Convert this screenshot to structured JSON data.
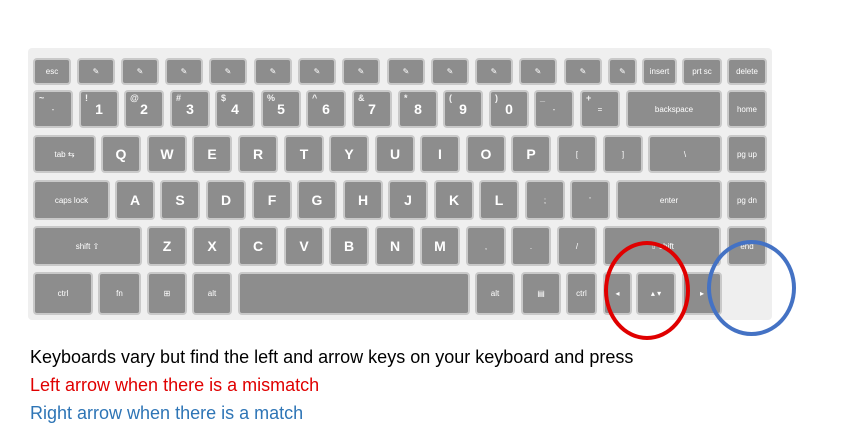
{
  "keyboard": {
    "rows": [
      [
        {
          "label": "esc"
        },
        {
          "label": "✎"
        },
        {
          "label": "✎"
        },
        {
          "label": "✎"
        },
        {
          "label": "✎"
        },
        {
          "label": "✎"
        },
        {
          "label": "✎"
        },
        {
          "label": "✎"
        },
        {
          "label": "✎"
        },
        {
          "label": "✎"
        },
        {
          "label": "✎"
        },
        {
          "label": "✎"
        },
        {
          "label": "✎"
        },
        {
          "label": "✎"
        },
        {
          "label": "insert"
        },
        {
          "label": "prt sc"
        },
        {
          "label": "delete"
        }
      ],
      [
        {
          "label": "-",
          "sec": "~"
        },
        {
          "label": "1",
          "sec": "!"
        },
        {
          "label": "2",
          "sec": "@"
        },
        {
          "label": "3",
          "sec": "#"
        },
        {
          "label": "4",
          "sec": "$"
        },
        {
          "label": "5",
          "sec": "%"
        },
        {
          "label": "6",
          "sec": "^"
        },
        {
          "label": "7",
          "sec": "&"
        },
        {
          "label": "8",
          "sec": "*"
        },
        {
          "label": "9",
          "sec": "("
        },
        {
          "label": "0",
          "sec": ")"
        },
        {
          "label": "-",
          "sec": "_"
        },
        {
          "label": "=",
          "sec": "+"
        },
        {
          "label": "backspace"
        },
        {
          "label": "home"
        }
      ],
      [
        {
          "label": "tab ⇆"
        },
        {
          "label": "Q"
        },
        {
          "label": "W"
        },
        {
          "label": "E"
        },
        {
          "label": "R"
        },
        {
          "label": "T"
        },
        {
          "label": "Y"
        },
        {
          "label": "U"
        },
        {
          "label": "I"
        },
        {
          "label": "O"
        },
        {
          "label": "P"
        },
        {
          "label": "["
        },
        {
          "label": "]"
        },
        {
          "label": "\\"
        },
        {
          "label": "pg up"
        }
      ],
      [
        {
          "label": "caps lock"
        },
        {
          "label": "A"
        },
        {
          "label": "S"
        },
        {
          "label": "D"
        },
        {
          "label": "F"
        },
        {
          "label": "G"
        },
        {
          "label": "H"
        },
        {
          "label": "J"
        },
        {
          "label": "K"
        },
        {
          "label": "L"
        },
        {
          "label": ";"
        },
        {
          "label": "'"
        },
        {
          "label": "enter"
        },
        {
          "label": "pg dn"
        }
      ],
      [
        {
          "label": "shift ⇧"
        },
        {
          "label": "Z"
        },
        {
          "label": "X"
        },
        {
          "label": "C"
        },
        {
          "label": "V"
        },
        {
          "label": "B"
        },
        {
          "label": "N"
        },
        {
          "label": "M"
        },
        {
          "label": ","
        },
        {
          "label": "."
        },
        {
          "label": "/"
        },
        {
          "label": "⇧ shift"
        },
        {
          "label": "end"
        }
      ],
      [
        {
          "label": "ctrl"
        },
        {
          "label": "fn"
        },
        {
          "label": "⊞"
        },
        {
          "label": "alt"
        },
        {
          "label": ""
        },
        {
          "label": "alt"
        },
        {
          "label": "▤"
        },
        {
          "label": "ctrl"
        },
        {
          "label": "◂"
        },
        {
          "label": "▴ ▾"
        },
        {
          "label": "▸"
        }
      ]
    ]
  },
  "instructions": {
    "line1": "Keyboards vary but find the left and arrow keys on your keyboard and press",
    "line2": "Left arrow when there is a mismatch",
    "line3": "Right arrow when there is a match"
  },
  "colors": {
    "mismatch": "#e00000",
    "match": "#2e75b6",
    "key": "#8d8d8d"
  }
}
